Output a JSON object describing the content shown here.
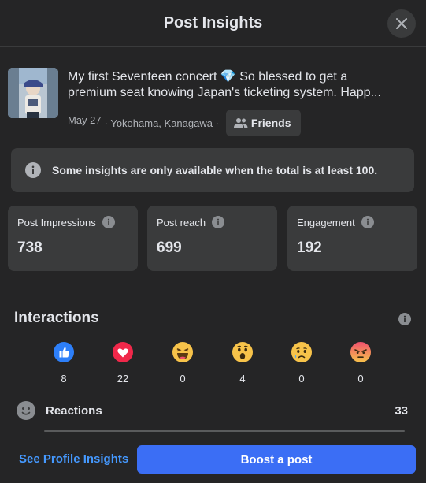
{
  "header": {
    "title": "Post Insights"
  },
  "post": {
    "line1": "My first Seventeen concert 💎 So blessed to get a",
    "line2": "premium seat knowing Japan's ticketing system. Happ...",
    "date": "May 27",
    "location": "· Yokohama, Kanagawa ·",
    "audience_label": "Friends"
  },
  "notice": {
    "text": "Some insights are only available when the total is at least 100."
  },
  "stats": [
    {
      "label": "Post Impressions",
      "value": "738"
    },
    {
      "label": "Post reach",
      "value": "699"
    },
    {
      "label": "Engagement",
      "value": "192"
    }
  ],
  "interactions": {
    "title": "Interactions",
    "reactions": [
      {
        "icon": "like-icon",
        "count": "8"
      },
      {
        "icon": "love-icon",
        "count": "22"
      },
      {
        "icon": "haha-icon",
        "count": "0"
      },
      {
        "icon": "wow-icon",
        "count": "4"
      },
      {
        "icon": "sad-icon",
        "count": "0"
      },
      {
        "icon": "angry-icon",
        "count": "0"
      }
    ],
    "reactions_label": "Reactions",
    "reactions_total": "33"
  },
  "footer": {
    "profile_link": "See Profile Insights",
    "boost_label": "Boost a post"
  },
  "colors": {
    "background": "#252526",
    "card": "#3a3b3c",
    "accent": "#3b6ef5",
    "link": "#4599ff",
    "like": "#2d7ff9",
    "love": "#f0284a"
  }
}
